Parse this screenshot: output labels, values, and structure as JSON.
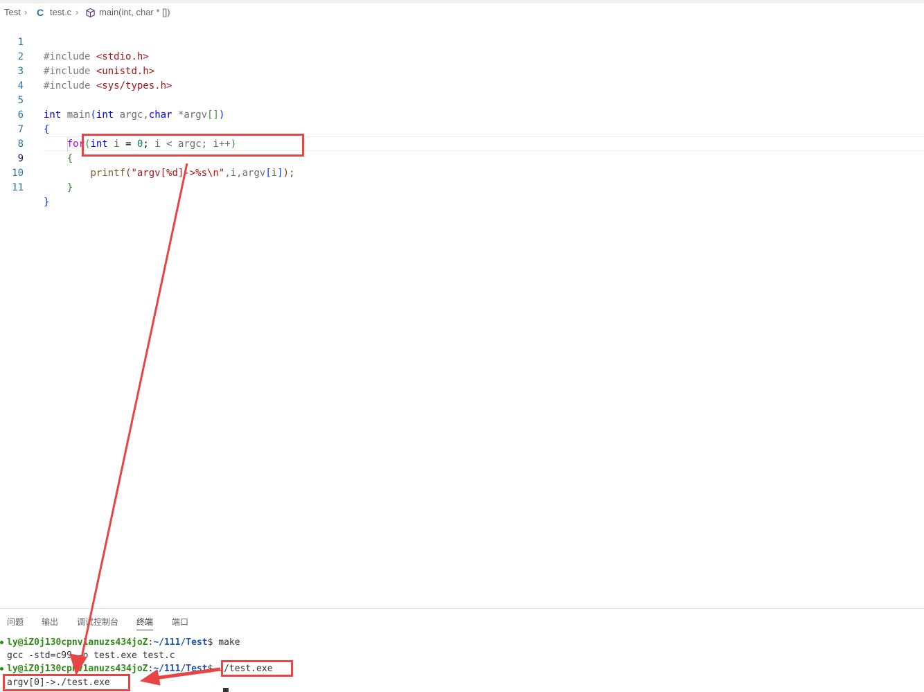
{
  "breadcrumb": {
    "folder": "Test",
    "file": "test.c",
    "symbol": "main(int, char * [])"
  },
  "editor": {
    "line_numbers": [
      "1",
      "2",
      "3",
      "4",
      "5",
      "6",
      "7",
      "8",
      "9",
      "10",
      "11"
    ],
    "lines": {
      "l1": {
        "directive": "#include",
        "file": "<stdio.h>"
      },
      "l2": {
        "directive": "#include",
        "file": "<unistd.h>"
      },
      "l3": {
        "directive": "#include",
        "file": "<sys/types.h>"
      },
      "l5": {
        "type_int": "int",
        "name": "main",
        "open": "(",
        "param1_type": "int",
        "param1": "argc,",
        "param2_type": "char",
        "param2": "*argv",
        "brackets": "[]",
        "close": ")"
      },
      "l6": {
        "brace": "{"
      },
      "l7": {
        "kw_for": "for",
        "open": "(",
        "type_int": "int",
        "var_i": "i",
        "eq": "=",
        "zero": "0",
        "semi1": ";",
        "cmp": "i < argc;",
        "inc": "i++",
        "close": ")"
      },
      "l8": {
        "brace": "{"
      },
      "l9": {
        "fn": "printf",
        "open": "(",
        "str1": "\"argv[%d]->%s",
        "esc": "\\n",
        "str2": "\"",
        "args": ",i,argv",
        "idx_open": "[",
        "idx": "i",
        "idx_close": "]",
        "close": ");"
      },
      "l10": {
        "brace": "}"
      },
      "l11": {
        "brace": "}"
      }
    }
  },
  "panel": {
    "tabs": [
      "问题",
      "输出",
      "调试控制台",
      "终端",
      "端口"
    ],
    "active_tab": "终端"
  },
  "terminal": {
    "line1": {
      "user": "ly@iZ0j130cpnv1anuzs434joZ",
      "sep": ":",
      "path": "~/111/Test",
      "dollar": "$",
      "cmd": "make"
    },
    "line2": "gcc -std=c99 -o test.exe test.c",
    "line3": {
      "user": "ly@iZ0j130cpnv1anuzs434joZ",
      "sep": ":",
      "path": "~/111/Test",
      "dollar": "$",
      "cmd": "./test.exe"
    },
    "line4": "argv[0]->./test.exe"
  },
  "annotations": {
    "box_color": "#e84444",
    "arrow_color": "#e84444"
  }
}
